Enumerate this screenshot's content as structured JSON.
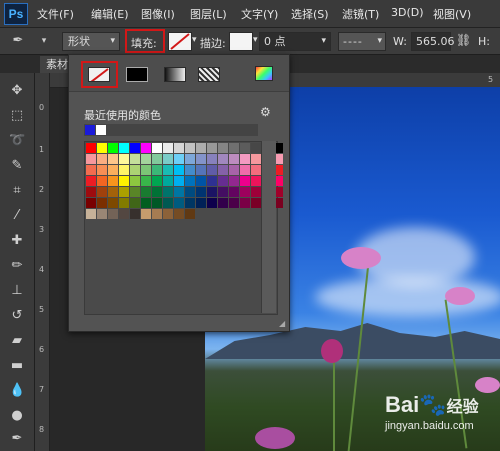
{
  "app": {
    "logo": "Ps"
  },
  "menu": [
    "文件(F)",
    "编辑(E)",
    "图像(I)",
    "图层(L)",
    "文字(Y)",
    "选择(S)",
    "滤镜(T)",
    "3D(D)",
    "视图(V)"
  ],
  "options": {
    "shape_mode": "形状",
    "fill_label": "填充:",
    "stroke_label": "描边:",
    "stroke_width": "0 点",
    "width_label": "W:",
    "width_value": "565.06",
    "height_label": "H:"
  },
  "document": {
    "tab_label": "素材"
  },
  "ruler": {
    "h": [
      "5"
    ],
    "v": [
      "0",
      "1",
      "2",
      "3",
      "4",
      "5",
      "6",
      "7",
      "8"
    ]
  },
  "panel": {
    "title": "最近使用的颜色",
    "fill_types": [
      "no-color",
      "solid",
      "gradient",
      "pattern"
    ],
    "recent_colors": [
      "#1a1ad8",
      "#ffffff"
    ],
    "swatch_rows": [
      [
        "#ff0000",
        "#ffff00",
        "#00ff00",
        "#00ffff",
        "#0000ff",
        "#ff00ff",
        "#ffffff",
        "#ebebeb",
        "#d6d6d6",
        "#c2c2c2",
        "#adadad",
        "#999999",
        "#858585",
        "#707070",
        "#5c5c5c",
        "#474747",
        "#333333",
        "#000000"
      ],
      [
        "#f6989d",
        "#f9ad81",
        "#fdc68a",
        "#fff79a",
        "#c4df9b",
        "#a3d39c",
        "#82ca9c",
        "#7accc8",
        "#6dcff6",
        "#7da7d9",
        "#8393ca",
        "#8781bd",
        "#a187be",
        "#bd8cbf",
        "#f49ac1",
        "#f5989d",
        "#f6989d",
        "#f79bb1"
      ],
      [
        "#f26c4f",
        "#f68e55",
        "#fbaf5d",
        "#fff467",
        "#acd373",
        "#7cc576",
        "#3bb878",
        "#1abbb4",
        "#00bff3",
        "#438ccb",
        "#5574b9",
        "#605ca8",
        "#8560a8",
        "#a763a8",
        "#f06eaa",
        "#f26d7d",
        "#f26c4f",
        "#ed1c24"
      ],
      [
        "#ed1c24",
        "#f26522",
        "#f7941d",
        "#fff200",
        "#8dc73f",
        "#39b54a",
        "#00a651",
        "#00a99d",
        "#00aeef",
        "#0072bc",
        "#0054a6",
        "#2e3192",
        "#662d91",
        "#92278f",
        "#ec008c",
        "#ed145b",
        "#ed1c24",
        "#ff0066"
      ],
      [
        "#9e0b0f",
        "#a0410d",
        "#a3620a",
        "#aba000",
        "#598527",
        "#197b30",
        "#007236",
        "#00746b",
        "#0076a3",
        "#004b80",
        "#003471",
        "#1b1464",
        "#440e62",
        "#630460",
        "#9e005d",
        "#9e0039",
        "#9e0b0f",
        "#a0002a"
      ],
      [
        "#790000",
        "#7b2e00",
        "#7d4900",
        "#827b00",
        "#406618",
        "#005e20",
        "#005826",
        "#005952",
        "#005b7f",
        "#003663",
        "#002157",
        "#0d004c",
        "#32004b",
        "#4b0049",
        "#7b0046",
        "#7a0026",
        "#790000",
        "#7a0020"
      ],
      [
        "#c7b299",
        "#998675",
        "#736357",
        "#534741",
        "#37302d",
        "#c69c6d",
        "#a67c52",
        "#8c6239",
        "#754c24",
        "#603913"
      ]
    ]
  },
  "watermark": {
    "brand": "Bai",
    "jingyan": "经验",
    "url": "jingyan.baidu.com"
  }
}
